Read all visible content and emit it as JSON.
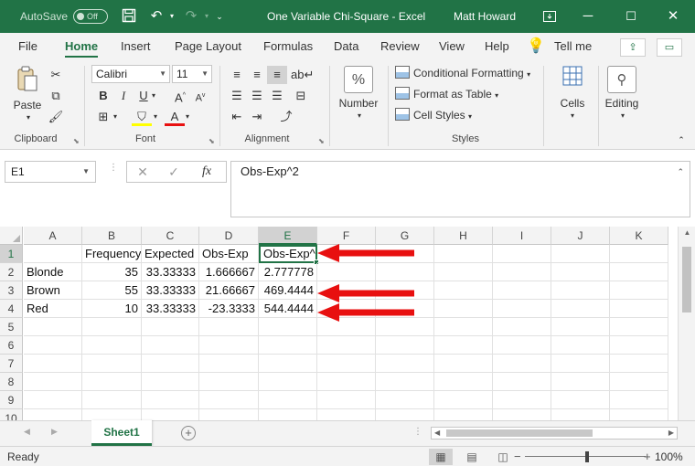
{
  "titlebar": {
    "autosave_label": "AutoSave",
    "autosave_state": "Off",
    "workbook_title": "One Variable Chi-Square  -  Excel",
    "user_name": "Matt Howard"
  },
  "ribbon_tabs": [
    "File",
    "Home",
    "Insert",
    "Page Layout",
    "Formulas",
    "Data",
    "Review",
    "View",
    "Help",
    "Tell me"
  ],
  "active_tab": "Home",
  "ribbon": {
    "clipboard": {
      "paste": "Paste",
      "group": "Clipboard"
    },
    "font": {
      "family": "Calibri",
      "size": "11",
      "group": "Font"
    },
    "alignment": {
      "group": "Alignment"
    },
    "number": {
      "label": "Number"
    },
    "styles": {
      "conditional": "Conditional Formatting",
      "format_table": "Format as Table",
      "cell_styles": "Cell Styles",
      "group": "Styles"
    },
    "cells": {
      "label": "Cells"
    },
    "editing": {
      "label": "Editing"
    }
  },
  "formula_bar": {
    "name_box": "E1",
    "cancel": "✕",
    "enter": "✓",
    "fx": "fx",
    "content": "Obs-Exp^2"
  },
  "grid": {
    "columns": [
      "A",
      "B",
      "C",
      "D",
      "E",
      "F",
      "G",
      "H",
      "I",
      "J",
      "K"
    ],
    "selected_column": "E",
    "row_numbers": [
      "1",
      "2",
      "3",
      "4",
      "5",
      "6",
      "7",
      "8",
      "9",
      "10"
    ],
    "selected_row": "1",
    "cells": {
      "B1": "Frequency",
      "C1": "Expected",
      "D1": "Obs-Exp",
      "E1": "Obs-Exp^2",
      "A2": "Blonde",
      "B2": "35",
      "C2": "33.33333",
      "D2": "1.666667",
      "E2": "2.777778",
      "A3": "Brown",
      "B3": "55",
      "C3": "33.33333",
      "D3": "21.66667",
      "E3": "469.4444",
      "A4": "Red",
      "B4": "10",
      "C4": "33.33333",
      "D4": "-23.3333",
      "E4": "544.4444"
    }
  },
  "annotation_color": "#e81010",
  "sheet_tabs": [
    "Sheet1"
  ],
  "status": {
    "ready": "Ready",
    "zoom": "100%"
  }
}
